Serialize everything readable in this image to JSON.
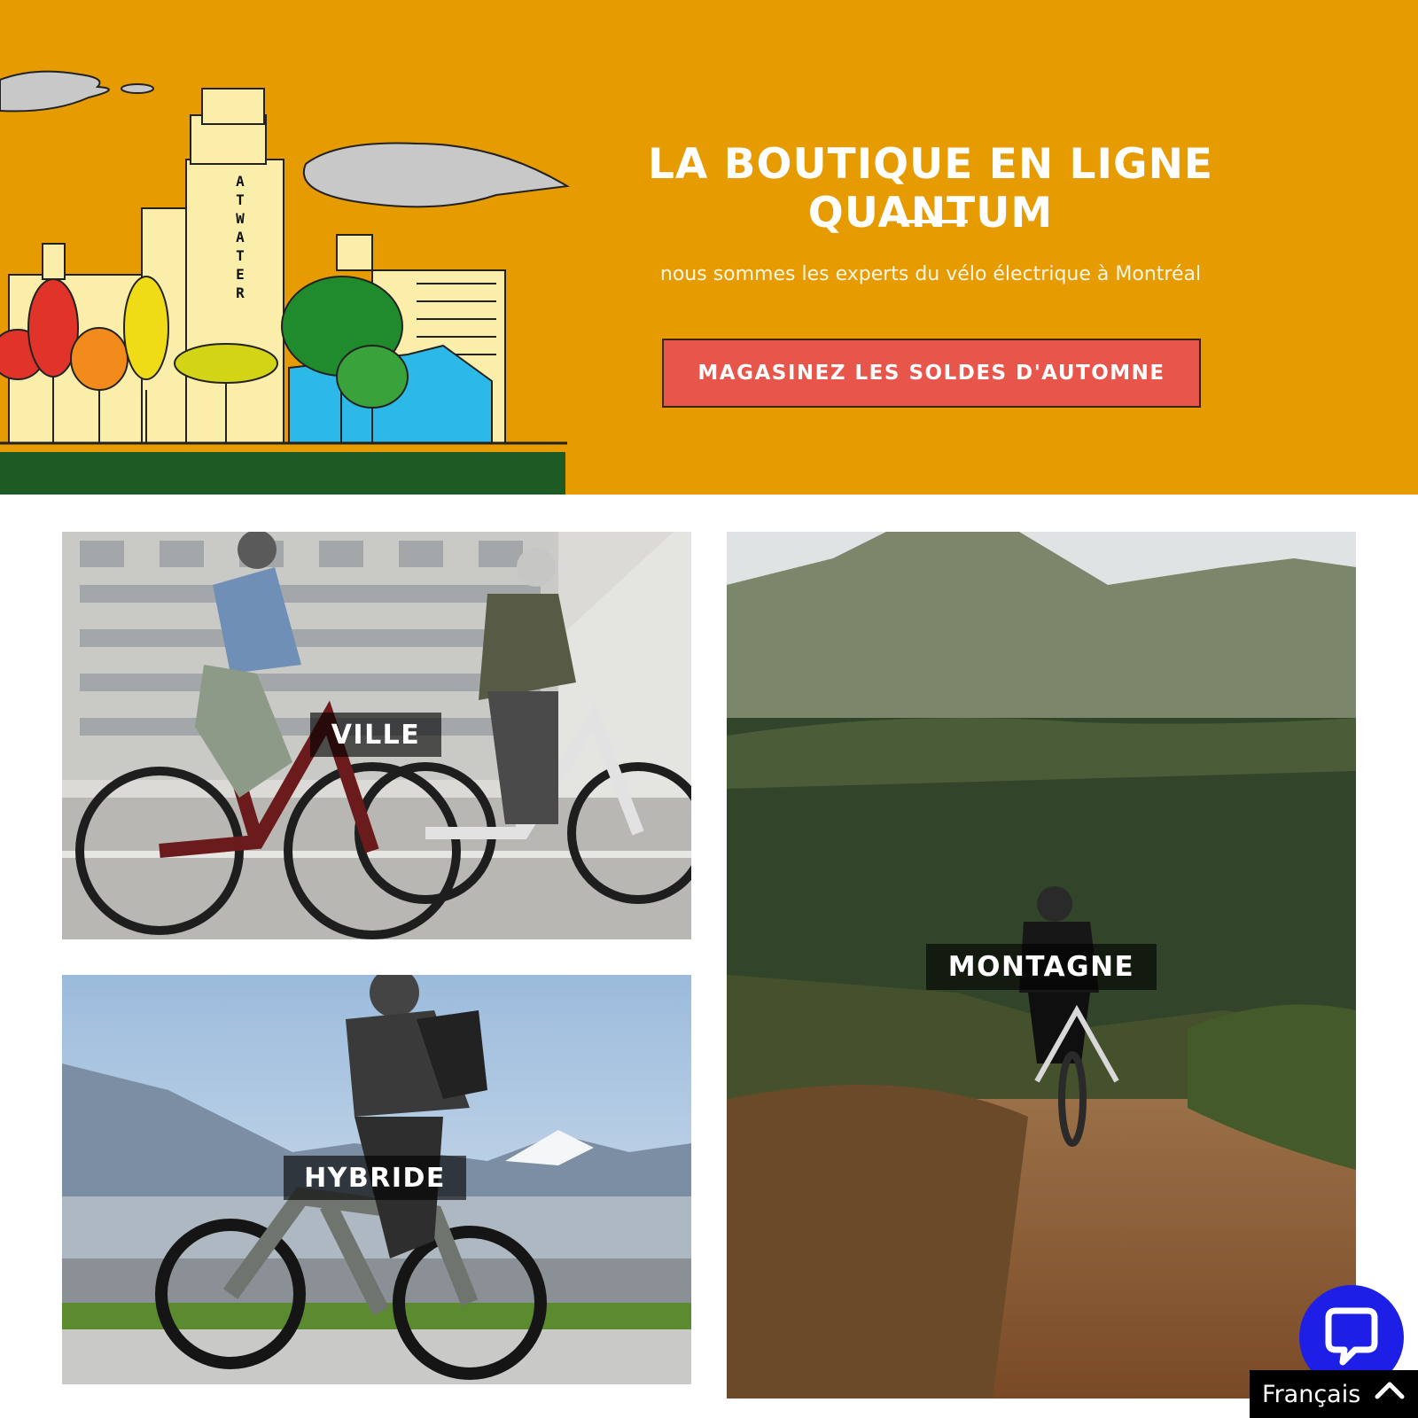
{
  "hero": {
    "title": "LA BOUTIQUE EN LIGNE QUANTUM",
    "subtitle": "nous sommes les experts du vélo électrique à Montréal",
    "cta_label": "MAGASINEZ LES SOLDES D'AUTOMNE",
    "building_sign": "ATWATER",
    "background_color": "#e69b00",
    "cta_color": "#e8554b"
  },
  "categories": [
    {
      "label": "VILLE"
    },
    {
      "label": "HYBRIDE"
    },
    {
      "label": "MONTAGNE"
    }
  ],
  "chat": {
    "icon": "chat-bubble-icon",
    "color": "#1d1ee6"
  },
  "language": {
    "label": "Français",
    "icon": "chevron-up-icon"
  }
}
